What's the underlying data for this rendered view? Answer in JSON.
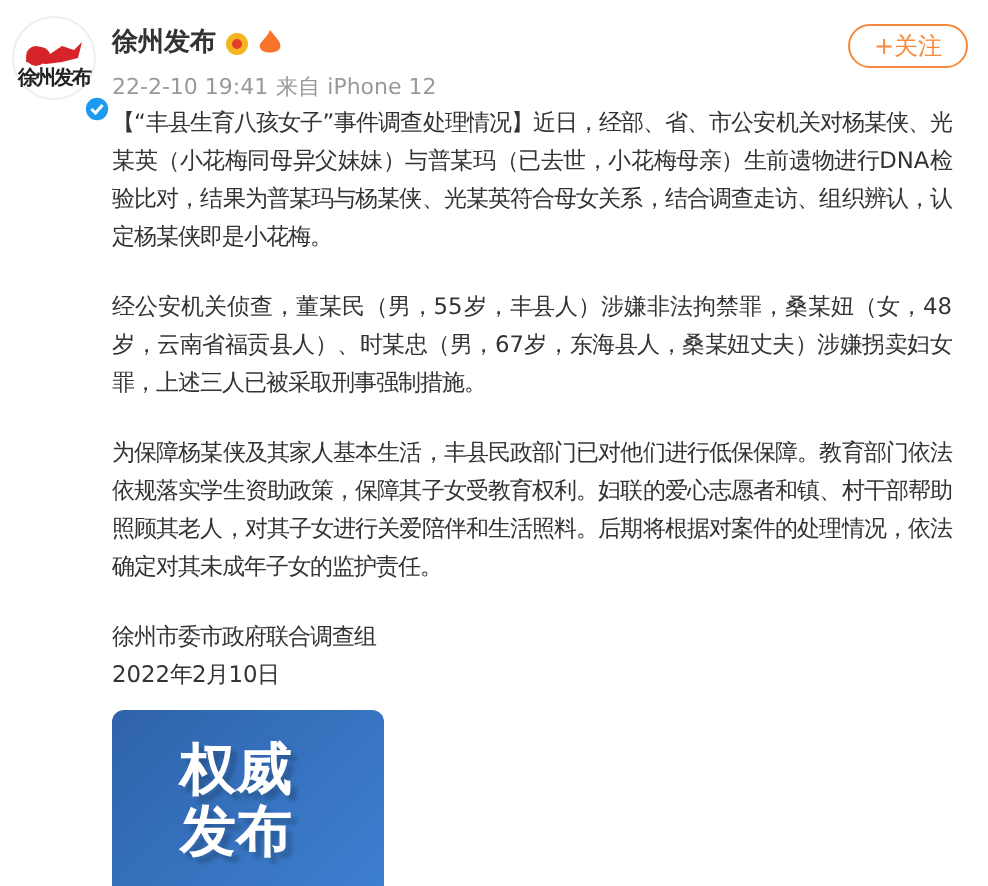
{
  "author": {
    "avatar_text": "徐州发布",
    "name": "徐州发布",
    "verified": true,
    "follow_button": "+关注"
  },
  "meta": {
    "time": "22-2-10 19:41",
    "source": "来自 iPhone 12"
  },
  "paragraphs": [
    "【“丰县生育八孩女子”事件调查处理情况】近日，经部、省、市公安机关对杨某侠、光某英（小花梅同母异父妹妹）与普某玛（已去世，小花梅母亲）生前遗物进行DNA检验比对，结果为普某玛与杨某侠、光某英符合母女关系，结合调查走访、组织辨认，认定杨某侠即是小花梅。",
    "经公安机关侦查，董某民（男，55岁，丰县人）涉嫌非法拘禁罪，桑某妞（女，48岁，云南省福贡县人）、时某忠（男，67岁，东海县人，桑某妞丈夫）涉嫌拐卖妇女罪，上述三人已被采取刑事强制措施。",
    "为保障杨某侠及其家人基本生活，丰县民政部门已对他们进行低保保障。教育部门依法依规落实学生资助政策，保障其子女受教育权利。妇联的爱心志愿者和镇、村干部帮助照顾其老人，对其子女进行关爱陪伴和生活照料。后期将根据对案件的处理情况，依法确定对其未成年子女的监护责任。"
  ],
  "signature": [
    "徐州市委市政府联合调查组",
    "2022年2月10日"
  ],
  "image_card": {
    "lines": [
      "权威",
      "发布"
    ]
  }
}
